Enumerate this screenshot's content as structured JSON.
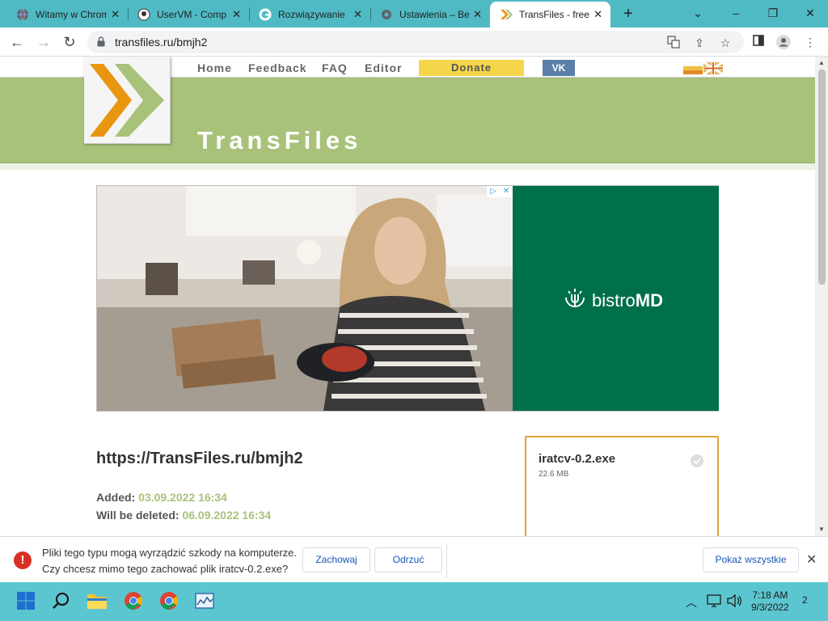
{
  "browser": {
    "tabs": [
      {
        "title": "Witamy w Chrome",
        "favicon": "globe-icon"
      },
      {
        "title": "UserVM - Comp",
        "favicon": "uservm-icon"
      },
      {
        "title": "Rozwiązywanie",
        "favicon": "google-icon"
      },
      {
        "title": "Ustawienia – Be",
        "favicon": "gear-icon"
      },
      {
        "title": "TransFiles - free",
        "favicon": "transfiles-icon",
        "active": true
      }
    ],
    "new_tab": "+",
    "url": "transfiles.ru/bmjh2"
  },
  "site": {
    "nav": [
      "Home",
      "Feedback",
      "FAQ",
      "Editor"
    ],
    "donate": "Donate",
    "vk": "VK",
    "title": "TransFiles",
    "accent": "#a8c27a"
  },
  "ad": {
    "brand_light": "bistro",
    "brand_bold": "MD",
    "bg": "#00704a"
  },
  "file": {
    "link": "https://TransFiles.ru/bmjh2",
    "added_label": "Added:",
    "added_value": "03.09.2022 16:34",
    "deleted_label": "Will be deleted:",
    "deleted_value": "06.09.2022 16:34",
    "name": "iratcv-0.2.exe",
    "size": "22.6 MB"
  },
  "download_bar": {
    "line1": "Pliki tego typu mogą wyrządzić szkody na komputerze.",
    "line2": "Czy chcesz mimo tego zachować plik iratcv-0.2.exe?",
    "keep": "Zachowaj",
    "discard": "Odrzuć",
    "show_all": "Pokaż wszystkie"
  },
  "taskbar": {
    "time": "7:18 AM",
    "date": "9/3/2022",
    "notifications": "2"
  }
}
